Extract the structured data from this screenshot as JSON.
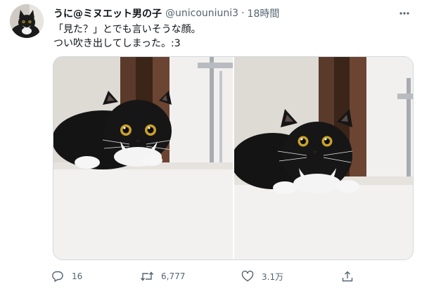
{
  "tweet": {
    "display_name": "うに@ミヌエット男の子",
    "handle": "@unicouniuni3",
    "separator": "·",
    "time": "18時間",
    "text_lines": [
      "「見た？」とでも言いそうな顔。",
      "つい吹き出してしまった。:3"
    ]
  },
  "actions": {
    "reply_count": "16",
    "retweet_count": "6,777",
    "like_count": "3.1万"
  },
  "icons": {
    "reply": "comment-icon",
    "retweet": "retweet-icon",
    "like": "heart-icon",
    "share": "share-icon",
    "more": "more-icon"
  },
  "colors": {
    "text_primary": "#0f1419",
    "text_secondary": "#536471",
    "border": "#cfd9de"
  }
}
